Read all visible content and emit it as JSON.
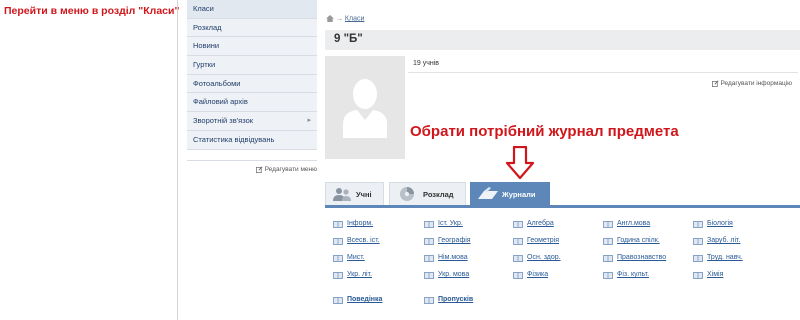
{
  "instructions": {
    "step1": "Перейти в меню в розділ \"Класи\"",
    "step2": "Обрати потрібний журнал предмета"
  },
  "sidebar": {
    "items": [
      {
        "label": "Класи"
      },
      {
        "label": "Розклад"
      },
      {
        "label": "Новини"
      },
      {
        "label": "Гуртки"
      },
      {
        "label": "Фотоальбоми"
      },
      {
        "label": "Файловий архів"
      },
      {
        "label": "Зворотній зв'язок",
        "arrow": "▸"
      },
      {
        "label": "Статистика відвідувань"
      }
    ],
    "edit_label": "Редагувати меню"
  },
  "breadcrumb": {
    "arrow": "→",
    "current": "Класи"
  },
  "class": {
    "title": "9 \"Б\"",
    "students": "19 учнів",
    "edit_label": "Редагувати інформацію"
  },
  "tabs": [
    {
      "label": "Учні",
      "icon": "users-icon"
    },
    {
      "label": "Розклад",
      "icon": "disc-icon"
    },
    {
      "label": "Журнали",
      "icon": "journal-icon",
      "active": true
    }
  ],
  "subjects": [
    [
      "Інформ.",
      "Іст. Укр.",
      "Алгебра",
      "Англ.мова",
      "Біологія"
    ],
    [
      "Всесв. іст.",
      "Географія",
      "Геометрія",
      "Година спілк.",
      "Заруб. літ."
    ],
    [
      "Мист.",
      "Нім.мова",
      "Осн. здор.",
      "Правознавство",
      "Труд. навч."
    ],
    [
      "Укр. літ.",
      "Укр. мова",
      "Фізика",
      "Фіз. культ.",
      "Хімія"
    ]
  ],
  "extra": [
    "Поведінка",
    "Пропусків"
  ],
  "colors": {
    "accent": "#5c87b8",
    "instruction": "#d0161b",
    "link": "#2a5a95"
  }
}
